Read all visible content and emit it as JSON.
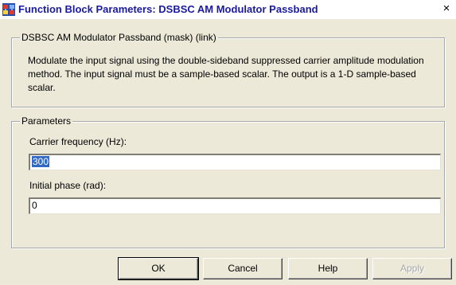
{
  "window": {
    "title": "Function Block Parameters: DSBSC AM Modulator Passband",
    "close_glyph": "×"
  },
  "block": {
    "group_title": "DSBSC AM Modulator Passband (mask) (link)",
    "description": "Modulate the input signal using the double-sideband suppressed carrier amplitude modulation method. The input signal must be a sample-based scalar. The output is a 1-D sample-based scalar."
  },
  "parameters": {
    "group_title": "Parameters",
    "carrier_frequency": {
      "label": "Carrier frequency (Hz):",
      "value": "300"
    },
    "initial_phase": {
      "label": "Initial phase (rad):",
      "value": "0"
    }
  },
  "buttons": {
    "ok": "OK",
    "cancel": "Cancel",
    "help": "Help",
    "apply": "Apply"
  },
  "colors": {
    "title_text": "#1a1a9e",
    "dialog_bg": "#ece9d8",
    "selection": "#316ac5"
  }
}
